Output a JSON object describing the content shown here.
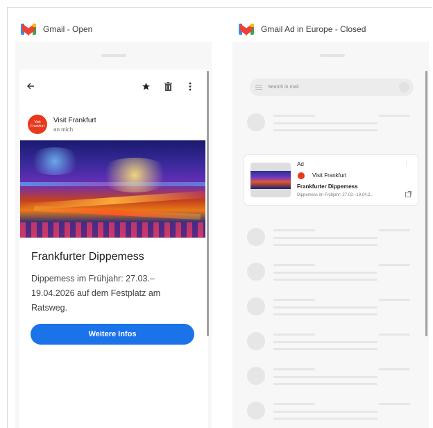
{
  "left_panel": {
    "header_label": "Gmail - Open",
    "toolbar": {
      "back_icon": "arrow-left-icon",
      "star_icon": "star-icon",
      "delete_icon": "trash-icon",
      "more_icon": "more-vert-icon"
    },
    "sender": {
      "name": "Visit Frankfurt",
      "recipient": "an mich",
      "avatar_text": "Visit Frankfurt",
      "avatar_color": "#e8391d"
    },
    "email": {
      "title": "Frankfurter Dippemess",
      "body": "Dippemess im Frühjahr: 27.03.–19.04.2026 auf dem Festplatz am Ratsweg.",
      "cta_label": "Weitere Infos",
      "cta_color": "#1a73e8"
    }
  },
  "right_panel": {
    "header_label": "Gmail Ad in Europe - Closed",
    "search_placeholder": "Search in mail",
    "ad": {
      "label": "Ad",
      "sender": "Visit Frankfurt",
      "subject": "Frankfurter Dippemess",
      "snippet": "Dippemess im Frühjahr: 27.03.–19.04.2...",
      "more_icon": "more-vert-icon",
      "external_icon": "open-external-icon"
    }
  }
}
